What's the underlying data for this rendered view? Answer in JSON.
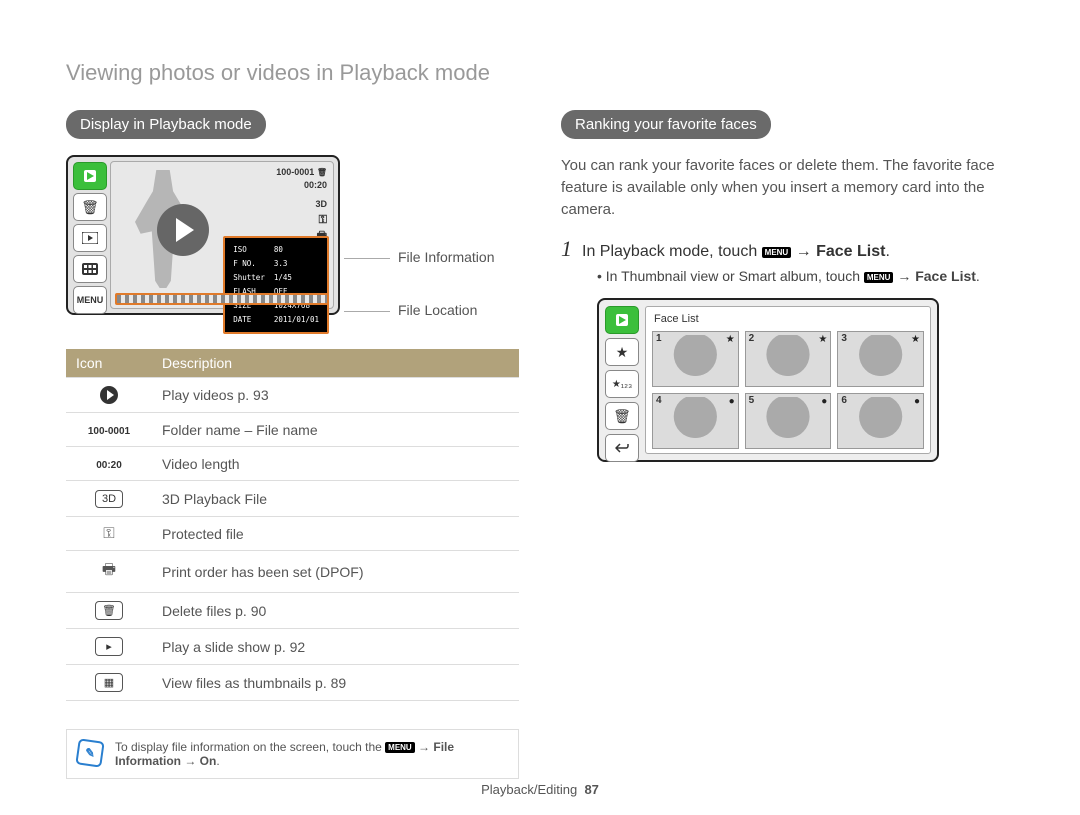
{
  "page_title": "Viewing photos or videos in Playback mode",
  "left": {
    "heading": "Display in Playback mode",
    "camera": {
      "file_number": "100-0001",
      "duration": "00:20",
      "info_block": [
        [
          "ISO",
          "80"
        ],
        [
          "F NO.",
          "3.3"
        ],
        [
          "Shutter",
          "1/45"
        ],
        [
          "FLASH",
          "OFF"
        ],
        [
          "SIZE",
          "1024X768"
        ],
        [
          "DATE",
          "2011/01/01"
        ]
      ],
      "menu_label": "MENU"
    },
    "callouts": {
      "file_information": "File Information",
      "file_location": "File Location"
    },
    "table": {
      "headers": {
        "icon": "Icon",
        "description": "Description"
      },
      "rows": [
        {
          "icon_type": "play-circle",
          "icon_text": "",
          "desc": "Play videos p. 93"
        },
        {
          "icon_type": "text",
          "icon_text": "100-0001",
          "desc": "Folder name – File name"
        },
        {
          "icon_type": "text",
          "icon_text": "00:20",
          "desc": "Video length"
        },
        {
          "icon_type": "badge",
          "icon_text": "3D",
          "desc": "3D Playback File"
        },
        {
          "icon_type": "glyph",
          "icon_text": "⚿",
          "desc": "Protected file"
        },
        {
          "icon_type": "glyph",
          "icon_text": "🖶",
          "desc": "Print order has been set (DPOF)"
        },
        {
          "icon_type": "badge",
          "icon_text": "🗑",
          "desc": "Delete files p. 90"
        },
        {
          "icon_type": "badge",
          "icon_text": "▸",
          "desc": "Play a slide show p. 92"
        },
        {
          "icon_type": "badge",
          "icon_text": "▦",
          "desc": "View files as thumbnails p. 89"
        }
      ]
    },
    "note": {
      "prefix": "To display file information on the screen, touch the ",
      "menu_chip": "MENU",
      "suffix": " → ",
      "bold1": "File Information",
      "then": " → ",
      "bold2": "On",
      "period": "."
    }
  },
  "right": {
    "heading": "Ranking your favorite faces",
    "intro": "You can rank your favorite faces or delete them. The favorite face feature is available only when you insert a memory card into the camera.",
    "step1": {
      "number": "1",
      "prefix": "In Playback mode, touch ",
      "menu_chip": "MENU",
      "arrow": " → ",
      "bold": "Face List",
      "period": "."
    },
    "sub_bullet": {
      "dot": "•",
      "prefix": "In Thumbnail view or Smart album, touch ",
      "menu_chip": "MENU",
      "arrow": " → ",
      "bold": "Face List",
      "period": "."
    },
    "face_list": {
      "title": "Face List",
      "cells": [
        {
          "n": "1",
          "mark": "★"
        },
        {
          "n": "2",
          "mark": "★"
        },
        {
          "n": "3",
          "mark": "★"
        },
        {
          "n": "4",
          "mark": "●"
        },
        {
          "n": "5",
          "mark": "●"
        },
        {
          "n": "6",
          "mark": "●"
        }
      ],
      "icons": {
        "star": "★",
        "star123": "★₁₂₃",
        "trash": "🗑"
      }
    }
  },
  "footer": {
    "section": "Playback/Editing",
    "page": "87"
  }
}
